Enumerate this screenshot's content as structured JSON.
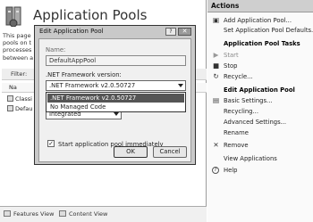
{
  "main": {
    "title": "Application Pools",
    "description_lines": [
      "This page",
      "pools on t",
      "processes",
      "between a"
    ],
    "filter_label": "Filter:",
    "column_name": "Na",
    "rows": [
      "Classi",
      "Defau"
    ]
  },
  "view_tabs": {
    "features": "Features View",
    "content": "Content View"
  },
  "actions": {
    "title": "Actions",
    "items": [
      {
        "label": "Add Application Pool...",
        "icon": "add-pool-icon",
        "glyph": "▣"
      },
      {
        "label": "Set Application Pool Defaults...",
        "icon": "",
        "glyph": ""
      },
      {
        "label": "Application Pool Tasks",
        "icon": "",
        "glyph": ""
      },
      {
        "label": "Start",
        "icon": "start-icon",
        "glyph": "▶"
      },
      {
        "label": "Stop",
        "icon": "stop-icon",
        "glyph": "■"
      },
      {
        "label": "Recycle...",
        "icon": "recycle-icon",
        "glyph": "↻"
      },
      {
        "label": "Edit Application Pool",
        "icon": "",
        "glyph": ""
      },
      {
        "label": "Basic Settings...",
        "icon": "settings-icon",
        "glyph": "▤"
      },
      {
        "label": "Recycling...",
        "icon": "",
        "glyph": ""
      },
      {
        "label": "Advanced Settings...",
        "icon": "",
        "glyph": ""
      },
      {
        "label": "Rename",
        "icon": "",
        "glyph": ""
      },
      {
        "label": "Remove",
        "icon": "remove-icon",
        "glyph": "✕"
      },
      {
        "label": "View Applications",
        "icon": "",
        "glyph": ""
      },
      {
        "label": "Help",
        "icon": "help-icon",
        "glyph": "?"
      }
    ]
  },
  "dialog": {
    "title": "Edit Application Pool",
    "help_glyph": "?",
    "close_glyph": "✕",
    "name_label": "Name:",
    "name_value": "DefaultAppPool",
    "framework_label": ".NET Framework version:",
    "framework_selected": ".NET Framework v2.0.50727",
    "framework_options": [
      ".NET Framework v2.0.50727",
      "No Managed Code"
    ],
    "pipeline_value": "Integrated",
    "start_immediately_label": "Start application pool immediately",
    "start_immediately_checked": "✓",
    "ok_label": "OK",
    "cancel_label": "Cancel"
  }
}
